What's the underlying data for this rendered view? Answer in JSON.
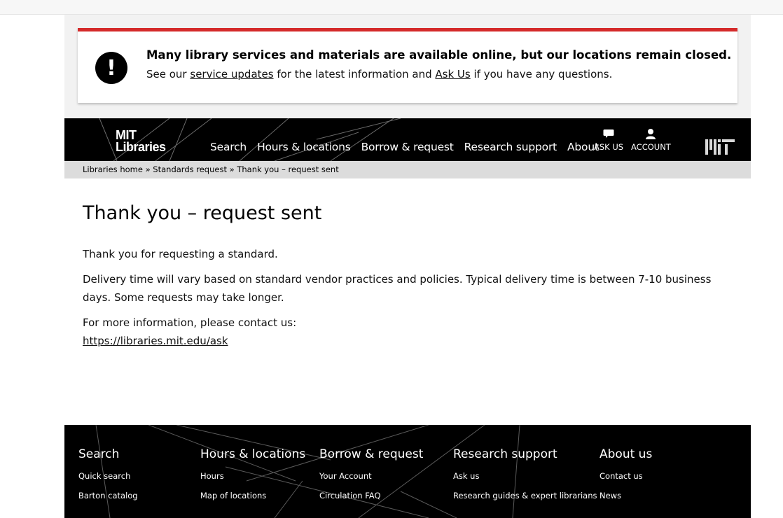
{
  "alert": {
    "icon": "exclamation-icon",
    "title": "Many library services and materials are available online, but our locations remain closed.",
    "text_prefix": "See our",
    "link1": "service updates",
    "text_middle": "for the latest information and",
    "link2": "Ask Us",
    "text_suffix": "if you have any questions.",
    "accent_color": "#d42a2a"
  },
  "nav": {
    "logo_line1": "MIT",
    "logo_line2": "Libraries",
    "items": [
      "Search",
      "Hours & locations",
      "Borrow & request",
      "Research support",
      "About"
    ],
    "ask_us": "ASK US",
    "account": "ACCOUNT"
  },
  "breadcrumb": {
    "home": "Libraries home",
    "sep": "»",
    "parent": "Standards request",
    "current": "Thank you – request sent"
  },
  "main": {
    "title": "Thank you – request sent",
    "p1": "Thank you for requesting a standard.",
    "p2": "Delivery time will vary based on standard vendor practices and policies. Typical delivery time is between 7-10 business days. Some requests may take longer.",
    "p3": "For more information, please contact us:",
    "link": "https://libraries.mit.edu/ask"
  },
  "footer": {
    "columns": [
      {
        "heading": "Search",
        "links": [
          "Quick search",
          "Barton catalog"
        ]
      },
      {
        "heading": "Hours & locations",
        "links": [
          "Hours",
          "Map of locations"
        ]
      },
      {
        "heading": "Borrow & request",
        "links": [
          "Your Account",
          "Circulation FAQ"
        ]
      },
      {
        "heading": "Research support",
        "links": [
          "Ask us",
          "Research guides & expert librarians"
        ]
      },
      {
        "heading": "About us",
        "links": [
          "Contact us",
          "News"
        ]
      }
    ]
  }
}
